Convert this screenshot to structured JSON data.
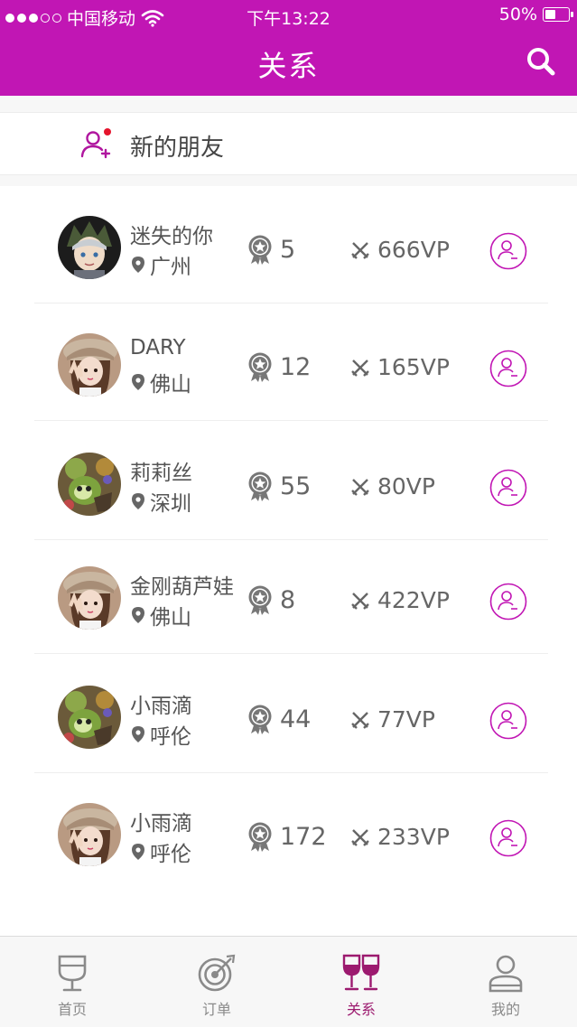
{
  "status_bar": {
    "carrier": "中国移动",
    "time": "下午13:22",
    "battery": "50%",
    "battery_level": 0.5
  },
  "header": {
    "title": "关系"
  },
  "new_friends": {
    "label": "新的朋友"
  },
  "friends": [
    {
      "name": "迷失的你",
      "city": "广州",
      "level": "5",
      "vp": "666VP",
      "avatar": "anime-boy"
    },
    {
      "name": "DARY",
      "city": "佛山",
      "level": "12",
      "vp": "165VP",
      "avatar": "girl-hat"
    },
    {
      "name": "莉莉丝",
      "city": "深圳",
      "level": "55",
      "vp": "80VP",
      "avatar": "game-creature"
    },
    {
      "name": "金刚葫芦娃",
      "city": "佛山",
      "level": "8",
      "vp": "422VP",
      "avatar": "girl-hat"
    },
    {
      "name": "小雨滴",
      "city": "呼伦",
      "level": "44",
      "vp": "77VP",
      "avatar": "game-creature"
    },
    {
      "name": "小雨滴",
      "city": "呼伦",
      "level": "172",
      "vp": "233VP",
      "avatar": "girl-hat"
    }
  ],
  "tabs": [
    {
      "label": "首页",
      "icon": "wine-glass-icon"
    },
    {
      "label": "订单",
      "icon": "target-icon"
    },
    {
      "label": "关系",
      "icon": "wine-glasses-cheers-icon",
      "active": true
    },
    {
      "label": "我的",
      "icon": "person-icon"
    }
  ],
  "colors": {
    "accent": "#c116b4",
    "tab_active": "#9c1a6f"
  }
}
